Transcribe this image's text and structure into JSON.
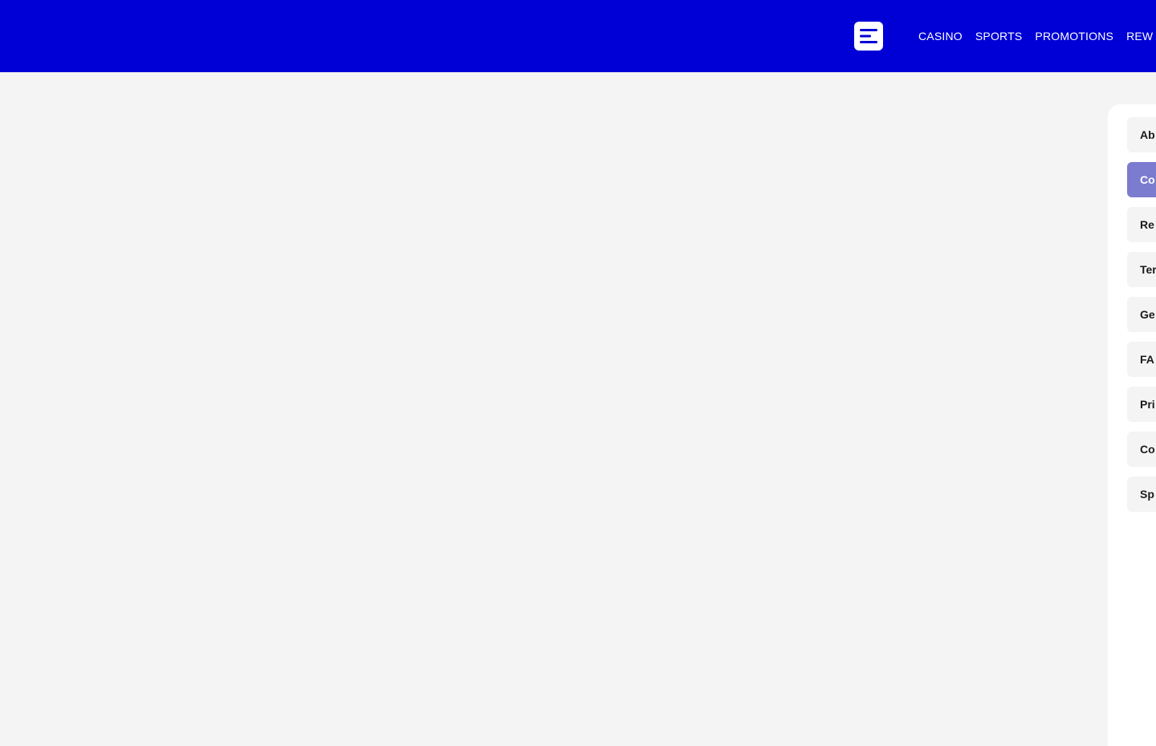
{
  "colors": {
    "header_bg": "#0000d6",
    "page_bg": "#f4f4f4",
    "panel_bg": "#ffffff",
    "active_item_bg": "#7b7bd0",
    "header_text": "#ffffff"
  },
  "header": {
    "menu_icon": "menu-lines-icon",
    "nav": [
      {
        "label": "CASINO"
      },
      {
        "label": "SPORTS"
      },
      {
        "label": "PROMOTIONS"
      },
      {
        "label": "REW"
      }
    ]
  },
  "sidebar": {
    "items": [
      {
        "label": "Ab"
      },
      {
        "label": "Co",
        "active": true
      },
      {
        "label": "Re"
      },
      {
        "label": "Ter"
      },
      {
        "label": "Ge"
      },
      {
        "label": "FA"
      },
      {
        "label": "Pri"
      },
      {
        "label": "Co"
      },
      {
        "label": "Sp"
      }
    ]
  }
}
